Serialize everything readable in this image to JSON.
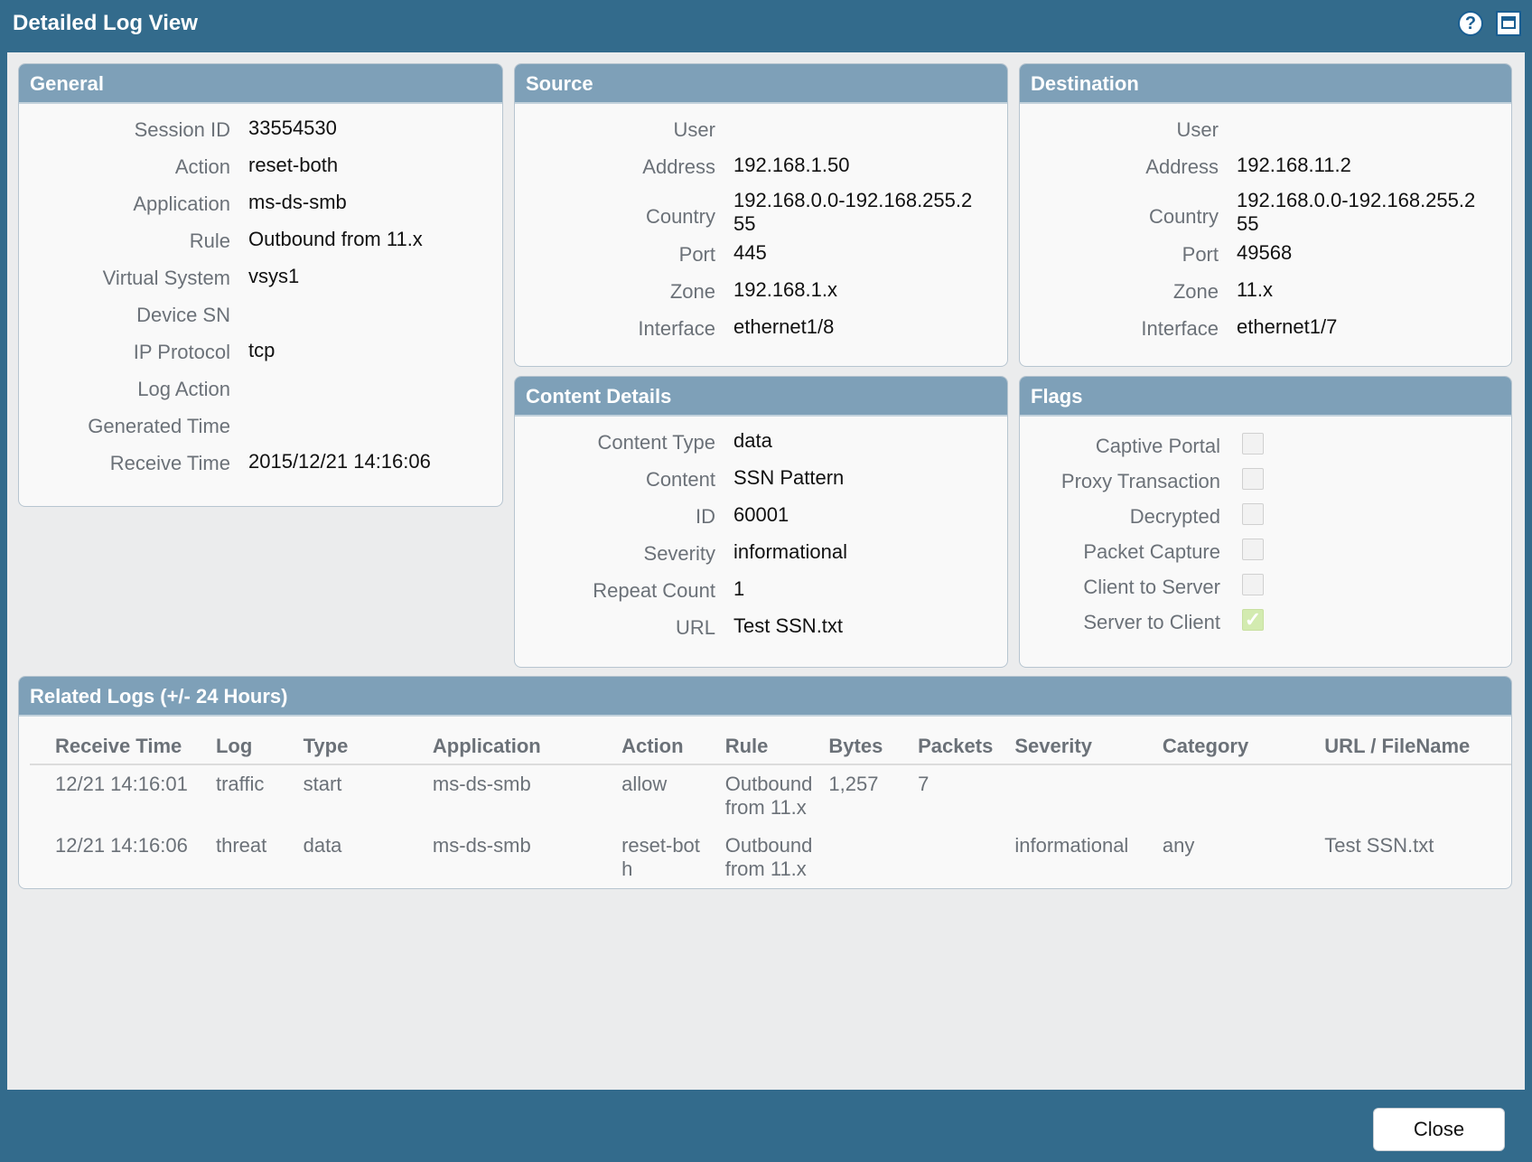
{
  "window": {
    "title": "Detailed Log View"
  },
  "general": {
    "title": "General",
    "rows": [
      {
        "label": "Session ID",
        "value": "33554530"
      },
      {
        "label": "Action",
        "value": "reset-both"
      },
      {
        "label": "Application",
        "value": "ms-ds-smb"
      },
      {
        "label": "Rule",
        "value": "Outbound from 11.x"
      },
      {
        "label": "Virtual System",
        "value": "vsys1"
      },
      {
        "label": "Device SN",
        "value": ""
      },
      {
        "label": "IP Protocol",
        "value": "tcp"
      },
      {
        "label": "Log Action",
        "value": ""
      },
      {
        "label": "Generated Time",
        "value": ""
      },
      {
        "label": "Receive Time",
        "value": "2015/12/21 14:16:06"
      }
    ]
  },
  "source": {
    "title": "Source",
    "rows": [
      {
        "label": "User",
        "value": ""
      },
      {
        "label": "Address",
        "value": "192.168.1.50"
      },
      {
        "label": "Country",
        "value": "192.168.0.0-192.168.255.2\n55"
      },
      {
        "label": "Port",
        "value": "445"
      },
      {
        "label": "Zone",
        "value": "192.168.1.x"
      },
      {
        "label": "Interface",
        "value": "ethernet1/8"
      }
    ]
  },
  "destination": {
    "title": "Destination",
    "rows": [
      {
        "label": "User",
        "value": ""
      },
      {
        "label": "Address",
        "value": "192.168.11.2"
      },
      {
        "label": "Country",
        "value": "192.168.0.0-192.168.255.2\n55"
      },
      {
        "label": "Port",
        "value": "49568"
      },
      {
        "label": "Zone",
        "value": "11.x"
      },
      {
        "label": "Interface",
        "value": "ethernet1/7"
      }
    ]
  },
  "content_details": {
    "title": "Content Details",
    "rows": [
      {
        "label": "Content Type",
        "value": "data"
      },
      {
        "label": "Content",
        "value": "SSN Pattern"
      },
      {
        "label": "ID",
        "value": "60001"
      },
      {
        "label": "Severity",
        "value": "informational"
      },
      {
        "label": "Repeat Count",
        "value": "1"
      },
      {
        "label": "URL",
        "value": "Test SSN.txt"
      }
    ]
  },
  "flags": {
    "title": "Flags",
    "items": [
      {
        "label": "Captive Portal",
        "checked": false
      },
      {
        "label": "Proxy Transaction",
        "checked": false
      },
      {
        "label": "Decrypted",
        "checked": false
      },
      {
        "label": "Packet Capture",
        "checked": false
      },
      {
        "label": "Client to Server",
        "checked": false
      },
      {
        "label": "Server to Client",
        "checked": true
      }
    ]
  },
  "related_logs": {
    "title": "Related Logs (+/- 24 Hours)",
    "columns": [
      "Receive Time",
      "Log",
      "Type",
      "Application",
      "Action",
      "Rule",
      "Bytes",
      "Packets",
      "Severity",
      "Category",
      "URL / FileName"
    ],
    "rows": [
      [
        "12/21 14:16:01",
        "traffic",
        "start",
        "ms-ds-smb",
        "allow",
        "Outbound\nfrom 11.x",
        "1,257",
        "7",
        "",
        "",
        ""
      ],
      [
        "12/21 14:16:06",
        "threat",
        "data",
        "ms-ds-smb",
        "reset-bot\nh",
        "Outbound\nfrom 11.x",
        "",
        "",
        "informational",
        "any",
        "Test SSN.txt"
      ]
    ]
  },
  "footer": {
    "close_label": "Close"
  }
}
